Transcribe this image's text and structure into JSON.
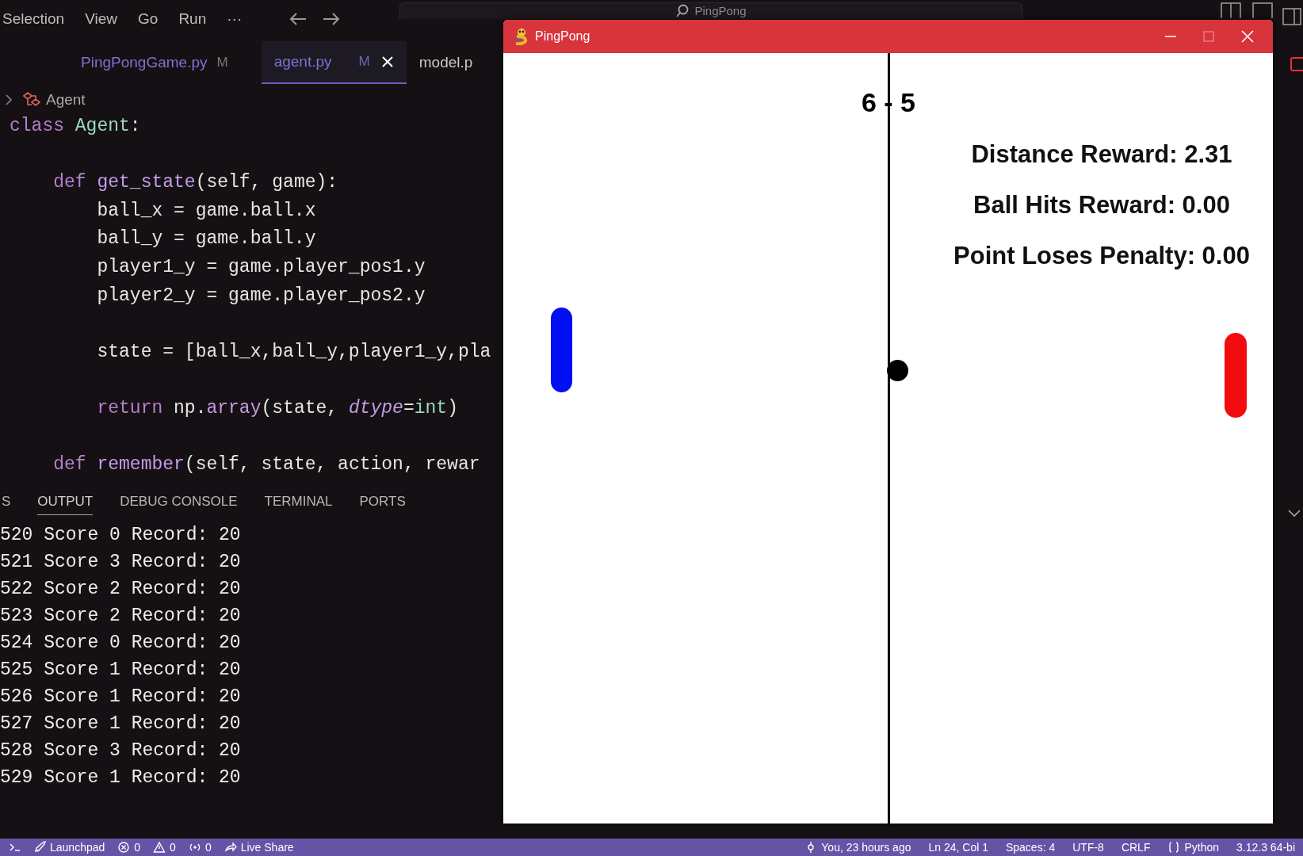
{
  "menu": [
    "Selection",
    "View",
    "Go",
    "Run",
    "···"
  ],
  "search": {
    "placeholder": "PingPong"
  },
  "tabs": [
    {
      "label": "PingPongGame.py",
      "badge": "M",
      "selected": false
    },
    {
      "label": "agent.py",
      "badge": "M",
      "selected": true
    },
    {
      "label": "model.p",
      "selected": false
    }
  ],
  "breadcrumb": "Agent",
  "code_blocks": [
    [
      [
        {
          "t": "class",
          "kind": "kw"
        },
        {
          "t": " Agent",
          "kind": "cls"
        },
        {
          "t": ":",
          "kind": "plain"
        }
      ]
    ],
    [
      [
        {
          "t": "    def",
          "kind": "kw"
        },
        {
          "t": " get_state",
          "kind": "fn"
        },
        {
          "t": "(self, game):",
          "kind": "plain"
        }
      ],
      [
        {
          "t": "        ball_x = game.ball.x",
          "kind": "plain"
        }
      ],
      [
        {
          "t": "        ball_y = game.ball.y",
          "kind": "plain"
        }
      ],
      [
        {
          "t": "        player1_y = game.player_pos1.y",
          "kind": "plain"
        }
      ],
      [
        {
          "t": "        player2_y = game.player_pos2.y",
          "kind": "plain"
        }
      ]
    ],
    [
      [
        {
          "t": "        state = [ball_x,ball_y,player1_y,pla",
          "kind": "plain"
        }
      ]
    ],
    [
      [
        {
          "t": "        return",
          "kind": "kw"
        },
        {
          "t": " np.",
          "kind": "plain"
        },
        {
          "t": "array",
          "kind": "fn"
        },
        {
          "t": "(state, ",
          "kind": "plain"
        },
        {
          "t": "dtype",
          "kind": "param"
        },
        {
          "t": "=",
          "kind": "plain"
        },
        {
          "t": "int",
          "kind": "cls"
        },
        {
          "t": ")",
          "kind": "plain"
        }
      ]
    ],
    [
      [
        {
          "t": "    def",
          "kind": "kw"
        },
        {
          "t": " remember",
          "kind": "fn"
        },
        {
          "t": "(self, state, action, rewar",
          "kind": "plain"
        }
      ]
    ]
  ],
  "panel_tabs": [
    {
      "label": "S",
      "selected": false
    },
    {
      "label": "OUTPUT",
      "selected": true
    },
    {
      "label": "DEBUG CONSOLE",
      "selected": false
    },
    {
      "label": "TERMINAL",
      "selected": false
    },
    {
      "label": "PORTS",
      "selected": false
    }
  ],
  "output": [
    "520 Score 0 Record: 20",
    "521 Score 3 Record: 20",
    "522 Score 2 Record: 20",
    "523 Score 2 Record: 20",
    "524 Score 0 Record: 20",
    "525 Score 1 Record: 20",
    "526 Score 1 Record: 20",
    "527 Score 1 Record: 20",
    "528 Score 3 Record: 20",
    "529 Score 1 Record: 20"
  ],
  "status_bar": {
    "left": [
      {
        "kind": "remote"
      },
      {
        "kind": "launchpad",
        "text": "Launchpad"
      },
      {
        "kind": "errors",
        "text": "0"
      },
      {
        "kind": "warnings",
        "text": "0"
      },
      {
        "kind": "ports",
        "text": "0"
      },
      {
        "kind": "share",
        "text": "Live Share"
      }
    ],
    "right": [
      {
        "kind": "blame",
        "text": "You, 23 hours ago"
      },
      {
        "kind": "plain",
        "text": "Ln 24, Col 1"
      },
      {
        "kind": "plain",
        "text": "Spaces: 4"
      },
      {
        "kind": "plain",
        "text": "UTF-8"
      },
      {
        "kind": "plain",
        "text": "CRLF"
      },
      {
        "kind": "python",
        "text": "Python"
      },
      {
        "kind": "plain",
        "text": "3.12.3 64-bi"
      }
    ]
  },
  "game_window": {
    "title": "PingPong",
    "score": "6 - 5",
    "stats": [
      "Distance Reward: 2.31",
      "Ball Hits Reward: 0.00",
      "Point Loses Penalty: 0.00"
    ]
  }
}
